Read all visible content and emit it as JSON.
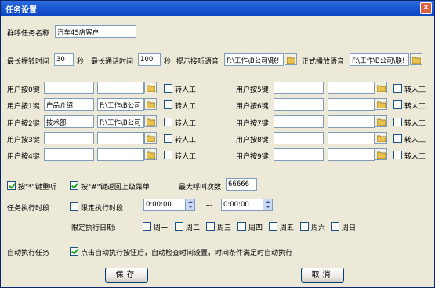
{
  "window": {
    "title": "任务设置",
    "close_glyph": "✕"
  },
  "task_name": {
    "label": "群呼任务名称",
    "value": "汽车4S店客户"
  },
  "max_ring": {
    "label": "最长振铃时间",
    "value": "30",
    "unit": "秒"
  },
  "max_call": {
    "label": "最长通话时间",
    "value": "100",
    "unit": "秒"
  },
  "prompt_voice": {
    "label": "提示接听语音",
    "value": "F:\\工作\\B公司\\联!"
  },
  "formal_voice": {
    "label": "正式播放语音",
    "value": "F:\\工作\\B公司\\联!"
  },
  "transfer_label": "转人工",
  "keys_left": [
    {
      "label": "用户按0键",
      "name": "",
      "path": ""
    },
    {
      "label": "用户按1键",
      "name": "产品介绍",
      "path": "F:\\工作\\B公司"
    },
    {
      "label": "用户按2键",
      "name": "技术部",
      "path": "F:\\工作\\B公司"
    },
    {
      "label": "用户按3键",
      "name": "",
      "path": ""
    },
    {
      "label": "用户按4键",
      "name": "",
      "path": ""
    }
  ],
  "keys_right": [
    {
      "label": "用户按5键",
      "name": "",
      "path": ""
    },
    {
      "label": "用户按6键",
      "name": "",
      "path": ""
    },
    {
      "label": "用户按7键",
      "name": "",
      "path": ""
    },
    {
      "label": "用户按8键",
      "name": "",
      "path": ""
    },
    {
      "label": "用户按9键",
      "name": "",
      "path": ""
    }
  ],
  "star_replay": {
    "label": "按\"*\"键重听",
    "checked": true
  },
  "hash_return": {
    "label": "按\"#\"键返回上级菜单",
    "checked": true
  },
  "max_calls": {
    "label": "最大呼叫次数",
    "value": "66666"
  },
  "exec_period": {
    "label": "任务执行时段",
    "limit_label": "限定执行时段",
    "start": "0:00:00",
    "end": "0:00:00",
    "tilde": "~"
  },
  "exec_date": {
    "label": "限定执行日期:",
    "days": [
      "周一",
      "周二",
      "周三",
      "周四",
      "周五",
      "周六",
      "周日"
    ]
  },
  "auto_exec": {
    "label": "自动执行任务",
    "desc": "点击自动执行按钮后，自动检查时间设置，时间条件满足时自动执行",
    "checked": true
  },
  "buttons": {
    "save": "保存",
    "cancel": "取消"
  }
}
